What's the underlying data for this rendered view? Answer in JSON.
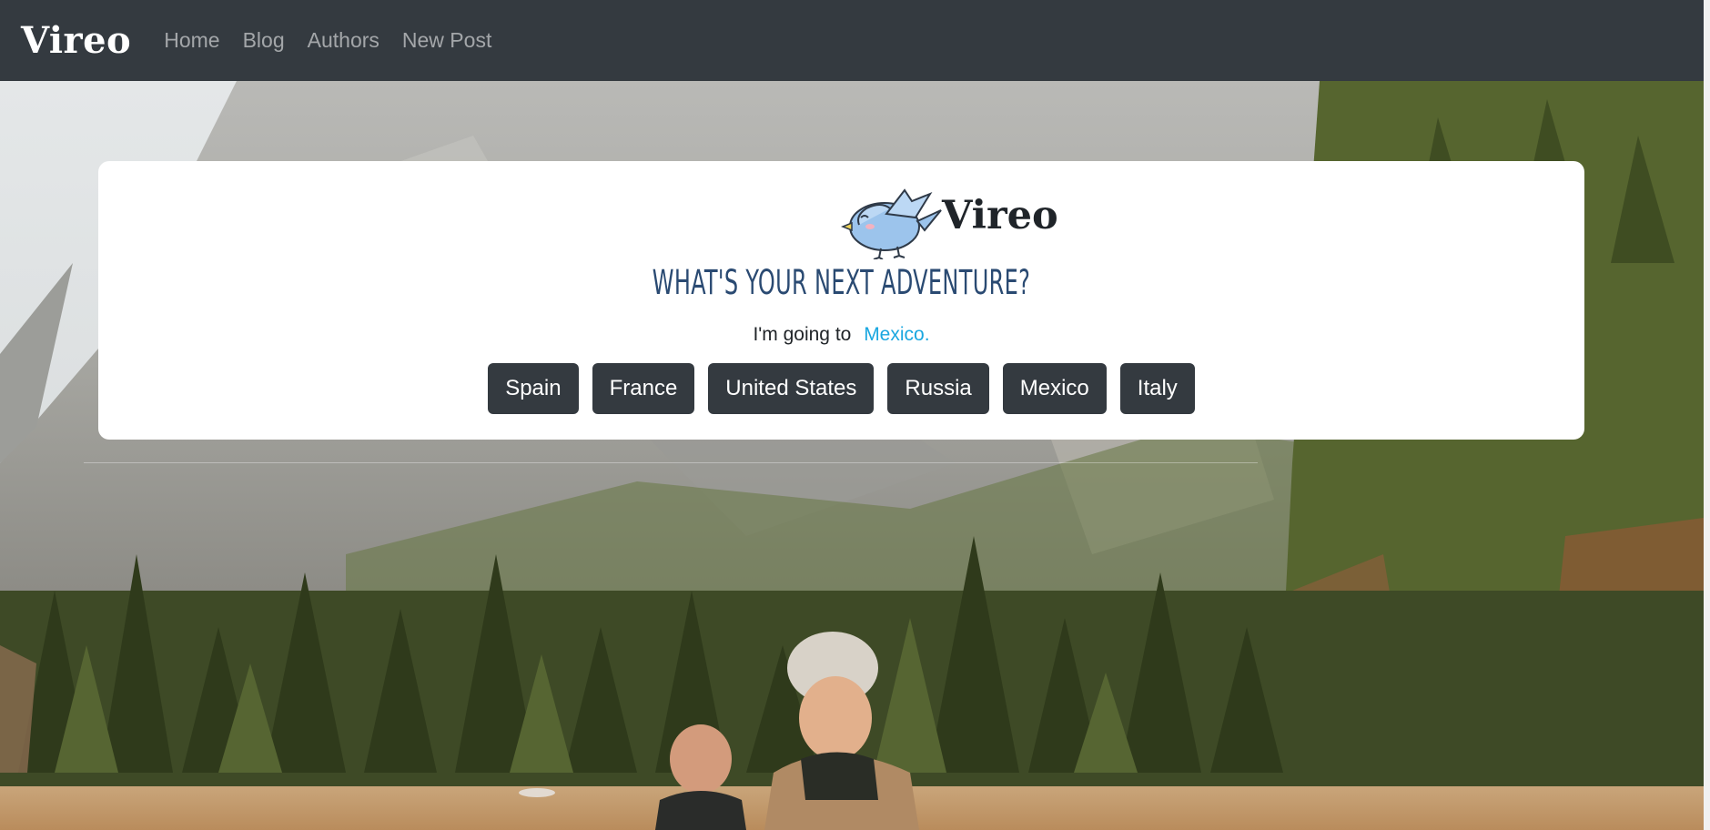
{
  "navbar": {
    "brand": "Vireo",
    "links": [
      "Home",
      "Blog",
      "Authors",
      "New Post"
    ]
  },
  "card": {
    "logo_text": "Vireo",
    "headline": "WHAT'S YOUR NEXT ADVENTURE?",
    "going_prefix": "I'm going to",
    "destination": "Mexico.",
    "countries": [
      "Spain",
      "France",
      "United States",
      "Russia",
      "Mexico",
      "Italy"
    ]
  },
  "colors": {
    "navbar": "#343a40",
    "button": "#343a40",
    "accent": "#1aa7e0",
    "headline": "#2a4a72"
  },
  "icons": [
    "bird-logo-icon"
  ]
}
